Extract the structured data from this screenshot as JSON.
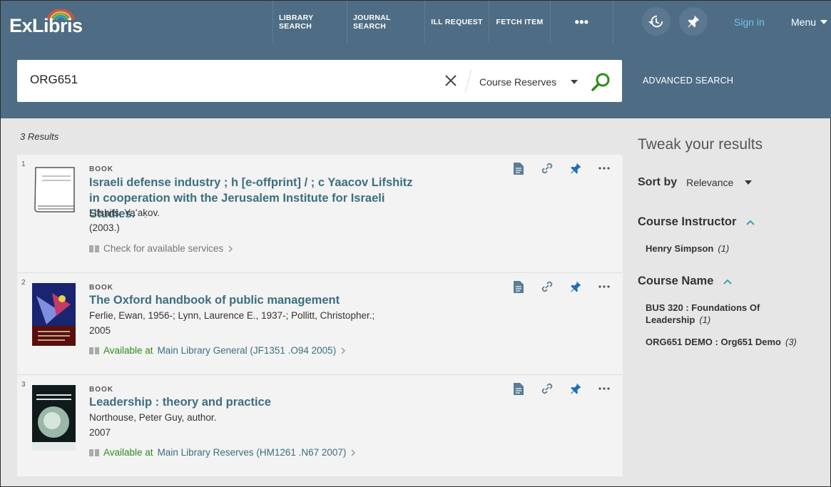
{
  "header": {
    "logo_text": "ExLibris",
    "nav": [
      "LIBRARY SEARCH",
      "JOURNAL SEARCH",
      "ILL REQUEST",
      "FETCH ITEM",
      "•••"
    ],
    "signin": "Sign in",
    "menu": "Menu"
  },
  "search": {
    "query": "ORG651",
    "scope": "Course Reserves",
    "advanced": "ADVANCED SEARCH"
  },
  "results": {
    "count_label": "3 Results",
    "items": [
      {
        "num": "1",
        "type": "BOOK",
        "title": "Israeli defense industry ; h [e-offprint] / ; c Yaacov Lifshitz in cooperation with the Jerusalem Institute for Israeli Studies.",
        "author": "Lifshits, Yaʻaḳov.",
        "date": "(2003.)",
        "availability": "Check for available services"
      },
      {
        "num": "2",
        "type": "BOOK",
        "title": "The Oxford handbook of public management",
        "author": "Ferlie, Ewan, 1956-; Lynn, Laurence E., 1937-; Pollitt, Christopher.;",
        "date": "2005",
        "avail_status": "Available at",
        "avail_location": "Main Library  General (JF1351 .O94 2005)"
      },
      {
        "num": "3",
        "type": "BOOK",
        "title": "Leadership : theory and practice",
        "author": "Northouse, Peter Guy, author.",
        "date": "2007",
        "avail_status": "Available at",
        "avail_location": "Main Library  Reserves (HM1261 .N67 2007)"
      }
    ]
  },
  "sidebar": {
    "title": "Tweak your results",
    "sort_label": "Sort by",
    "sort_value": "Relevance",
    "facets": [
      {
        "title": "Course Instructor",
        "values": [
          {
            "label": "Henry Simpson",
            "count": "(1)"
          }
        ]
      },
      {
        "title": "Course Name",
        "values": [
          {
            "label": "BUS 320 : Foundations Of Leadership",
            "count": "(1)"
          },
          {
            "label": "ORG651 DEMO : Org651 Demo",
            "count": "(3)"
          }
        ]
      }
    ]
  },
  "colors": {
    "header_bg": "#4e6d85",
    "title_link": "#3d6e80",
    "available_green": "#2e8b1e",
    "signin_blue": "#6ec3ef",
    "search_green": "#2e8b1e"
  }
}
